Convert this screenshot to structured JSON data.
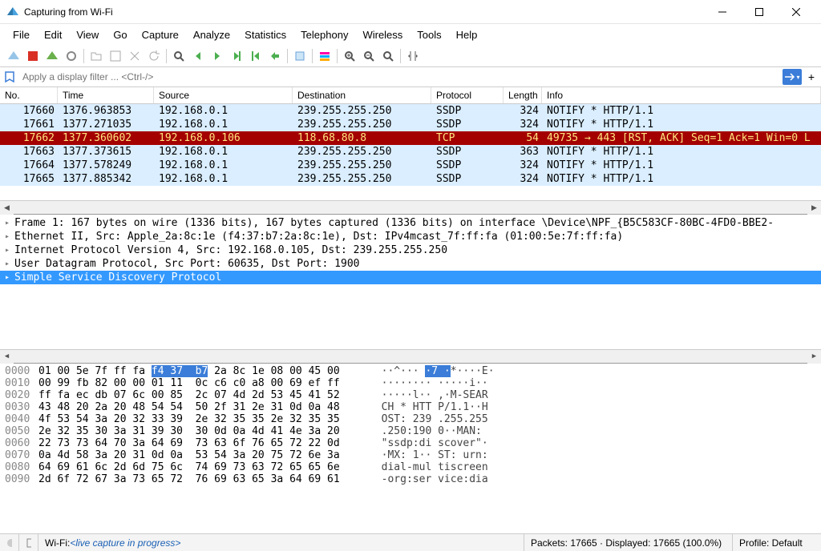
{
  "window": {
    "title": "Capturing from Wi-Fi"
  },
  "menu": {
    "items": [
      "File",
      "Edit",
      "View",
      "Go",
      "Capture",
      "Analyze",
      "Statistics",
      "Telephony",
      "Wireless",
      "Tools",
      "Help"
    ]
  },
  "filter": {
    "placeholder": "Apply a display filter ... <Ctrl-/>"
  },
  "columns": {
    "no": "No.",
    "time": "Time",
    "src": "Source",
    "dst": "Destination",
    "proto": "Protocol",
    "len": "Length",
    "info": "Info"
  },
  "packets": [
    {
      "no": "17660",
      "time": "1376.963853",
      "src": "192.168.0.1",
      "dst": "239.255.255.250",
      "proto": "SSDP",
      "len": "324",
      "info": "NOTIFY * HTTP/1.1",
      "class": "row-ssdp"
    },
    {
      "no": "17661",
      "time": "1377.271035",
      "src": "192.168.0.1",
      "dst": "239.255.255.250",
      "proto": "SSDP",
      "len": "324",
      "info": "NOTIFY * HTTP/1.1",
      "class": "row-ssdp"
    },
    {
      "no": "17662",
      "time": "1377.360602",
      "src": "192.168.0.106",
      "dst": "118.68.80.8",
      "proto": "TCP",
      "len": "54",
      "info": "49735 → 443 [RST, ACK] Seq=1 Ack=1 Win=0 L",
      "class": "row-tcp"
    },
    {
      "no": "17663",
      "time": "1377.373615",
      "src": "192.168.0.1",
      "dst": "239.255.255.250",
      "proto": "SSDP",
      "len": "363",
      "info": "NOTIFY * HTTP/1.1",
      "class": "row-ssdp"
    },
    {
      "no": "17664",
      "time": "1377.578249",
      "src": "192.168.0.1",
      "dst": "239.255.255.250",
      "proto": "SSDP",
      "len": "324",
      "info": "NOTIFY * HTTP/1.1",
      "class": "row-ssdp"
    },
    {
      "no": "17665",
      "time": "1377.885342",
      "src": "192.168.0.1",
      "dst": "239.255.255.250",
      "proto": "SSDP",
      "len": "324",
      "info": "NOTIFY * HTTP/1.1",
      "class": "row-ssdp"
    }
  ],
  "details": {
    "l0": "Frame 1: 167 bytes on wire (1336 bits), 167 bytes captured (1336 bits) on interface \\Device\\NPF_{B5C583CF-80BC-4FD0-BBE2-",
    "l1": "Ethernet II, Src: Apple_2a:8c:1e (f4:37:b7:2a:8c:1e), Dst: IPv4mcast_7f:ff:fa (01:00:5e:7f:ff:fa)",
    "l2": "Internet Protocol Version 4, Src: 192.168.0.105, Dst: 239.255.255.250",
    "l3": "User Datagram Protocol, Src Port: 60635, Dst Port: 1900",
    "l4": "Simple Service Discovery Protocol"
  },
  "bytes": [
    {
      "off": "0000",
      "hex1": "01 00 5e 7f ff fa ",
      "hl": "f4 37  b7",
      "hex2": " 2a 8c 1e 08 00 45 00",
      "asc1": "  ··^··· ",
      "asc_hl": "·7 ·",
      "asc2": "*····E·"
    },
    {
      "off": "0010",
      "hex": "00 99 fb 82 00 00 01 11  0c c6 c0 a8 00 69 ef ff",
      "asc": "  ········ ·····i··"
    },
    {
      "off": "0020",
      "hex": "ff fa ec db 07 6c 00 85  2c 07 4d 2d 53 45 41 52",
      "asc": "  ·····l·· ,·M-SEAR"
    },
    {
      "off": "0030",
      "hex": "43 48 20 2a 20 48 54 54  50 2f 31 2e 31 0d 0a 48",
      "asc": "  CH * HTT P/1.1··H"
    },
    {
      "off": "0040",
      "hex": "4f 53 54 3a 20 32 33 39  2e 32 35 35 2e 32 35 35",
      "asc": "  OST: 239 .255.255"
    },
    {
      "off": "0050",
      "hex": "2e 32 35 30 3a 31 39 30  30 0d 0a 4d 41 4e 3a 20",
      "asc": "  .250:190 0··MAN: "
    },
    {
      "off": "0060",
      "hex": "22 73 73 64 70 3a 64 69  73 63 6f 76 65 72 22 0d",
      "asc": "  \"ssdp:di scover\"·"
    },
    {
      "off": "0070",
      "hex": "0a 4d 58 3a 20 31 0d 0a  53 54 3a 20 75 72 6e 3a",
      "asc": "  ·MX: 1·· ST: urn:"
    },
    {
      "off": "0080",
      "hex": "64 69 61 6c 2d 6d 75 6c  74 69 73 63 72 65 65 6e",
      "asc": "  dial-mul tiscreen"
    },
    {
      "off": "0090",
      "hex": "2d 6f 72 67 3a 73 65 72  76 69 63 65 3a 64 69 61",
      "asc": "  -org:ser vice:dia"
    }
  ],
  "status": {
    "capture_label": "Wi-Fi: ",
    "capture_state": "<live capture in progress>",
    "packets": "Packets: 17665 · Displayed: 17665 (100.0%)",
    "profile": "Profile: Default"
  }
}
